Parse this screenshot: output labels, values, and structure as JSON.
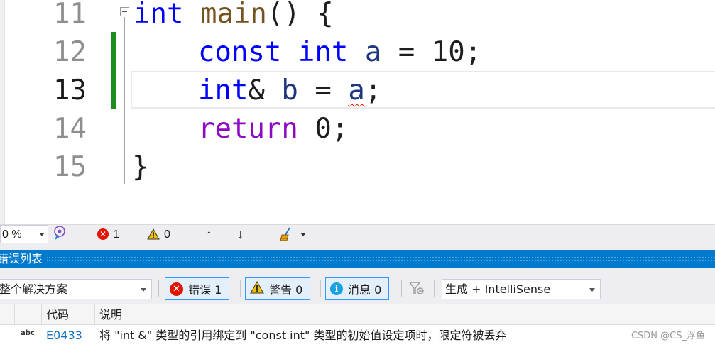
{
  "editor": {
    "lines": [
      {
        "number": "11",
        "current": false
      },
      {
        "number": "12",
        "current": false
      },
      {
        "number": "13",
        "current": true
      },
      {
        "number": "14",
        "current": false
      },
      {
        "number": "15",
        "current": false
      }
    ],
    "code": {
      "l11": {
        "kw": "int",
        "fn": "main",
        "rest": "() {"
      },
      "l12": {
        "kw1": "const",
        "kw2": "int",
        "var": "a",
        "op": "=",
        "num": "10;"
      },
      "l13": {
        "kw": "int",
        "amp": "&",
        "var_b": "b",
        "op": "=",
        "var_a": "a",
        "semi": ";"
      },
      "l14": {
        "ctl": "return",
        "num": "0;"
      },
      "l15": {
        "brace": "}"
      }
    }
  },
  "status_strip": {
    "zoom": "0 %",
    "errors": "1",
    "warnings": "0",
    "up_arrow": "↑",
    "down_arrow": "↓"
  },
  "error_list": {
    "title": "错误列表",
    "scope": "整个解决方案",
    "filter_errors": "错误 1",
    "filter_warnings": "警告 0",
    "filter_messages": "消息 0",
    "source": "生成 + IntelliSense",
    "columns": {
      "code": "代码",
      "description": "说明"
    },
    "rows": [
      {
        "icon_text": "abc",
        "code": "E0433",
        "description": "将 \"int &\" 类型的引用绑定到 \"const int\" 类型的初始值设定项时，限定符被丢弃"
      }
    ],
    "colors": {
      "accent": "#007acc",
      "error": "#e51400",
      "warning": "#f0c000",
      "info": "#1ba1e2"
    }
  },
  "watermark": "CSDN @CS_浮鱼"
}
